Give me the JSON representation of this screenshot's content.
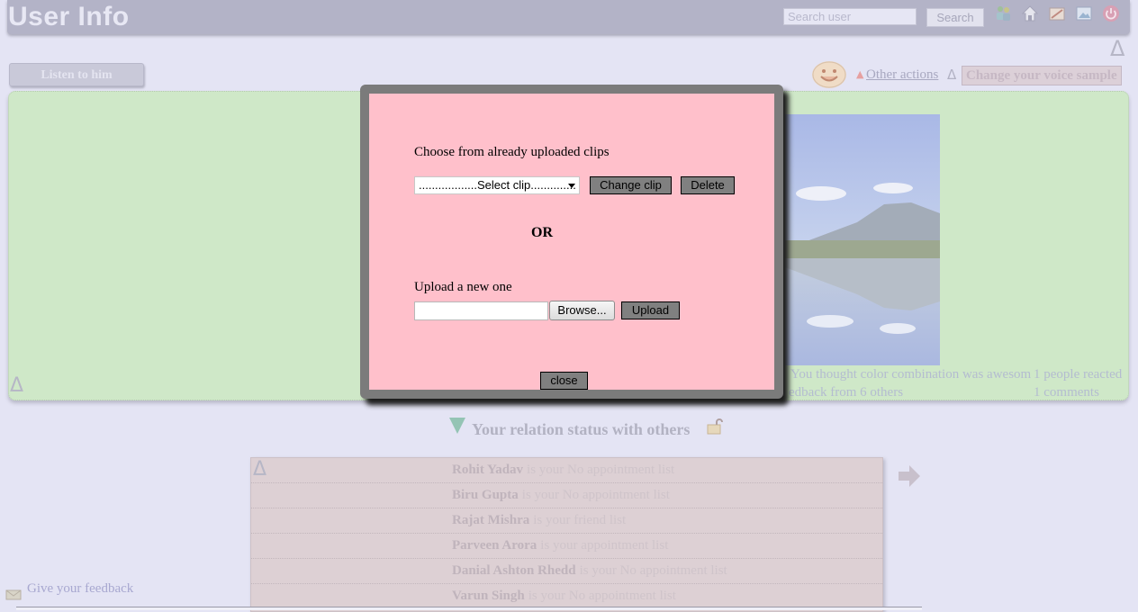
{
  "header": {
    "title": "User Info",
    "search_placeholder": "Search user",
    "search_button": "Search",
    "icons": [
      "users-icon",
      "home-icon",
      "settings-icon",
      "upload-icon",
      "power-icon"
    ]
  },
  "toolbar": {
    "listen_button": "Listen to him",
    "other_actions": "Other actions",
    "delta_symbol": "Δ",
    "change_voice": "Change your voice sample"
  },
  "post": {
    "reaction_text": "You thought color combination was awesom",
    "reaction_count": "1 people reacted",
    "feedback_text": "edback from 6 others",
    "comments": "1 comments"
  },
  "relations": {
    "title": "Your relation status with others",
    "rows": [
      {
        "name": "Rohit Yadav",
        "status": "is your No appointment list"
      },
      {
        "name": "Biru Gupta",
        "status": "is your No appointment list"
      },
      {
        "name": "Rajat Mishra",
        "status": "is your friend list"
      },
      {
        "name": "Parveen Arora",
        "status": "is your appointment list"
      },
      {
        "name": "Danial Ashton Rhedd",
        "status": "is your No appointment list"
      },
      {
        "name": "Varun Singh",
        "status": "is your No appointment list"
      }
    ]
  },
  "feedback_link": "Give your feedback",
  "modal": {
    "choose_label": "Choose from already uploaded clips",
    "select_value": "..................Select clip..............",
    "change_clip": "Change clip",
    "delete": "Delete",
    "or": "OR",
    "upload_label": "Upload a new one",
    "browse": "Browse...",
    "upload": "Upload",
    "close": "close"
  }
}
